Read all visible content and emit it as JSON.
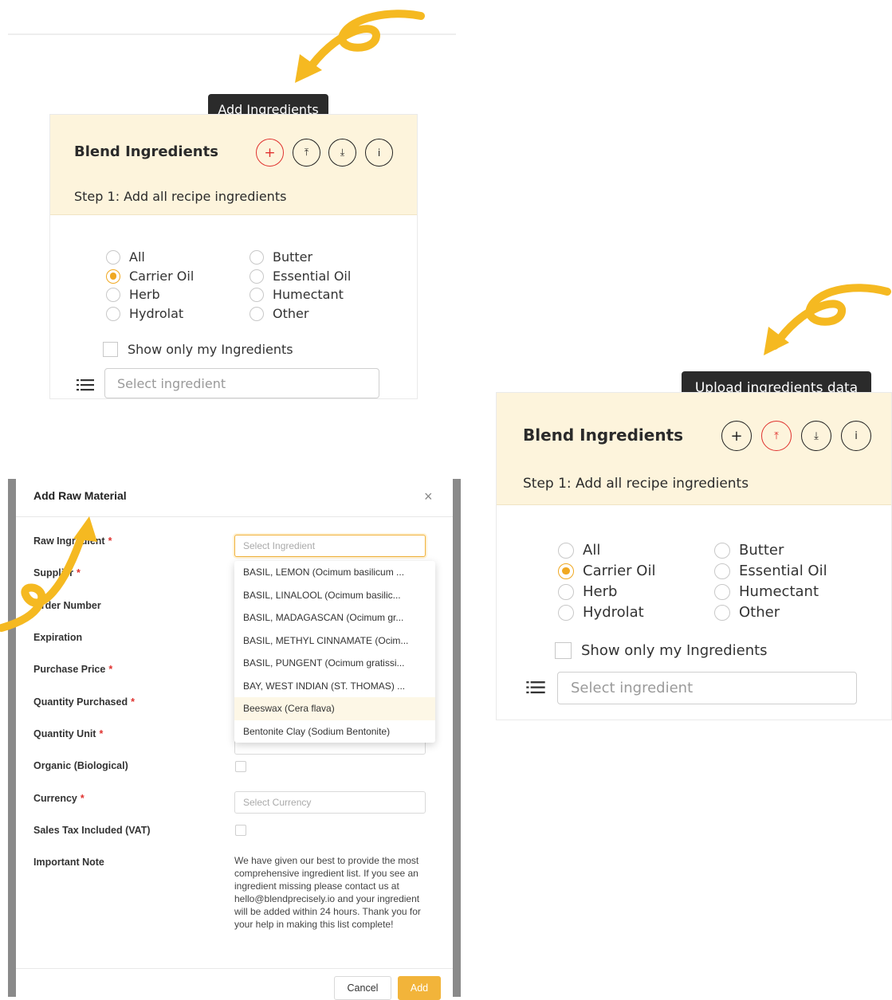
{
  "top_panel": {
    "tooltip": "Add Ingredients",
    "title": "Blend Ingredients",
    "step": "Step 1: Add all recipe ingredients",
    "buttons": {
      "add": "+",
      "upload": "⤒",
      "download": "⤓",
      "info": "i"
    },
    "categories": [
      {
        "label": "All",
        "checked": false
      },
      {
        "label": "Butter",
        "checked": false
      },
      {
        "label": "Carrier Oil",
        "checked": true
      },
      {
        "label": "Essential Oil",
        "checked": false
      },
      {
        "label": "Herb",
        "checked": false
      },
      {
        "label": "Humectant",
        "checked": false
      },
      {
        "label": "Hydrolat",
        "checked": false
      },
      {
        "label": "Other",
        "checked": false
      }
    ],
    "show_only_mine": "Show only my Ingredients",
    "select_placeholder": "Select ingredient"
  },
  "right_panel": {
    "tooltip": "Upload ingredients data",
    "title": "Blend Ingredients",
    "step": "Step 1: Add all recipe ingredients",
    "buttons": {
      "add": "+",
      "upload": "⤒",
      "download": "⤓",
      "info": "i"
    },
    "categories": [
      {
        "label": "All",
        "checked": false
      },
      {
        "label": "Butter",
        "checked": false
      },
      {
        "label": "Carrier Oil",
        "checked": true
      },
      {
        "label": "Essential Oil",
        "checked": false
      },
      {
        "label": "Herb",
        "checked": false
      },
      {
        "label": "Humectant",
        "checked": false
      },
      {
        "label": "Hydrolat",
        "checked": false
      },
      {
        "label": "Other",
        "checked": false
      }
    ],
    "show_only_mine": "Show only my Ingredients",
    "select_placeholder": "Select ingredient"
  },
  "modal": {
    "title": "Add Raw Material",
    "close": "×",
    "fields": {
      "raw_ingredient": "Raw Ingredient",
      "supplier": "Supplier",
      "order_number": "Order Number",
      "expiration": "Expiration",
      "purchase_price": "Purchase Price",
      "quantity_purchased": "Quantity Purchased",
      "quantity_unit": "Quantity Unit",
      "organic": "Organic (Biological)",
      "currency": "Currency",
      "sales_tax": "Sales Tax Included (VAT)",
      "important_note": "Important Note"
    },
    "required_mark": "*",
    "ingredient_placeholder": "Select Ingredient",
    "currency_placeholder": "Select Currency",
    "dropdown_options": [
      "BASIL, LEMON (Ocimum basilicum ...",
      "BASIL, LINALOOL (Ocimum basilic...",
      "BASIL, MADAGASCAN (Ocimum gr...",
      "BASIL, METHYL CINNAMATE (Ocim...",
      "BASIL, PUNGENT (Ocimum gratissi...",
      "BAY, WEST INDIAN (ST. THOMAS) ...",
      "Beeswax (Cera flava)",
      "Bentonite Clay (Sodium Bentonite)"
    ],
    "highlighted_option": 6,
    "note": "We have given our best to provide the most comprehensive ingredient list. If you see an ingredient missing please contact us at hello@blendprecisely.io and your ingredient will be added within 24 hours. Thank you for your help in making this list complete!",
    "cancel": "Cancel",
    "add": "Add"
  },
  "colors": {
    "accent": "#f0a821",
    "danger": "#e0322f",
    "panel_head": "#fdf4dc",
    "arrow": "#f5b921"
  }
}
